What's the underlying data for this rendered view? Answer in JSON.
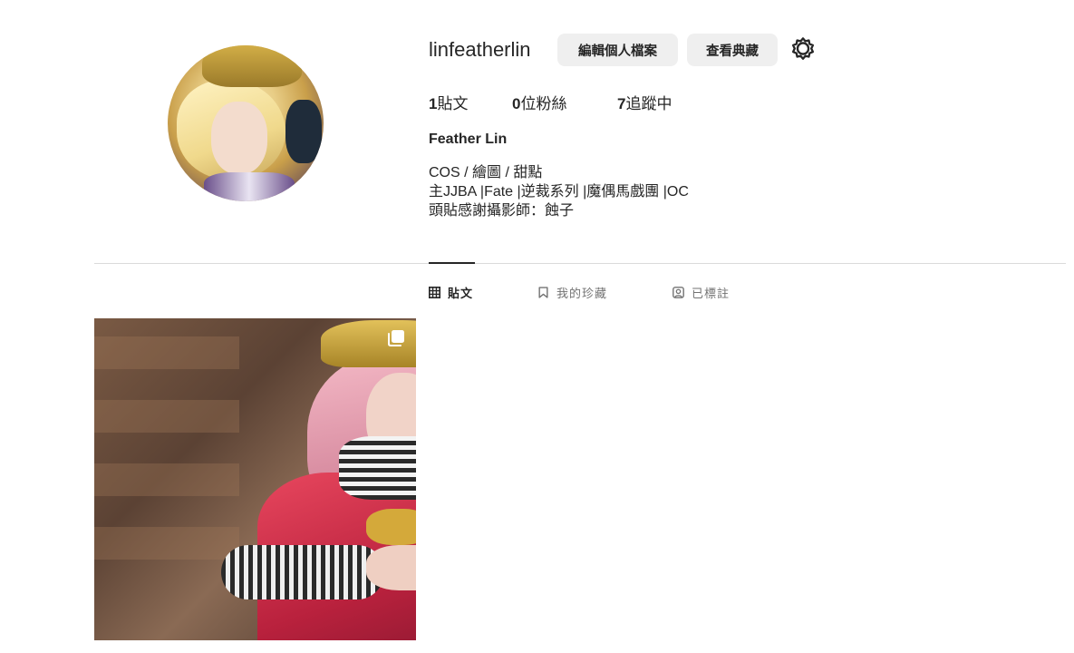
{
  "profile": {
    "username": "linfeatherlin",
    "full_name": "Feather Lin",
    "bio": [
      "COS / 繪圖 / 甜點",
      "主JJBA |Fate |逆裁系列 |魔偶馬戲團 |OC",
      "頭貼感謝攝影師：蝕子"
    ]
  },
  "actions": {
    "edit_profile": "編輯個人檔案",
    "view_archive": "查看典藏",
    "settings_icon": "gear-icon"
  },
  "stats": {
    "posts_count": "1",
    "posts_label": "貼文",
    "followers_count": "0",
    "followers_label": "位粉絲",
    "following_count": "7",
    "following_label": "追蹤中"
  },
  "tabs": [
    {
      "label": "貼文",
      "icon": "grid-icon",
      "active": true
    },
    {
      "label": "我的珍藏",
      "icon": "bookmark-icon",
      "active": false
    },
    {
      "label": "已標註",
      "icon": "tagged-user-icon",
      "active": false
    }
  ],
  "posts": [
    {
      "type": "carousel",
      "icon": "multiple-photos-icon"
    }
  ],
  "colors": {
    "text": "#262626",
    "muted": "#737373",
    "button_bg": "#efefef",
    "divider": "#dbdbdb"
  }
}
